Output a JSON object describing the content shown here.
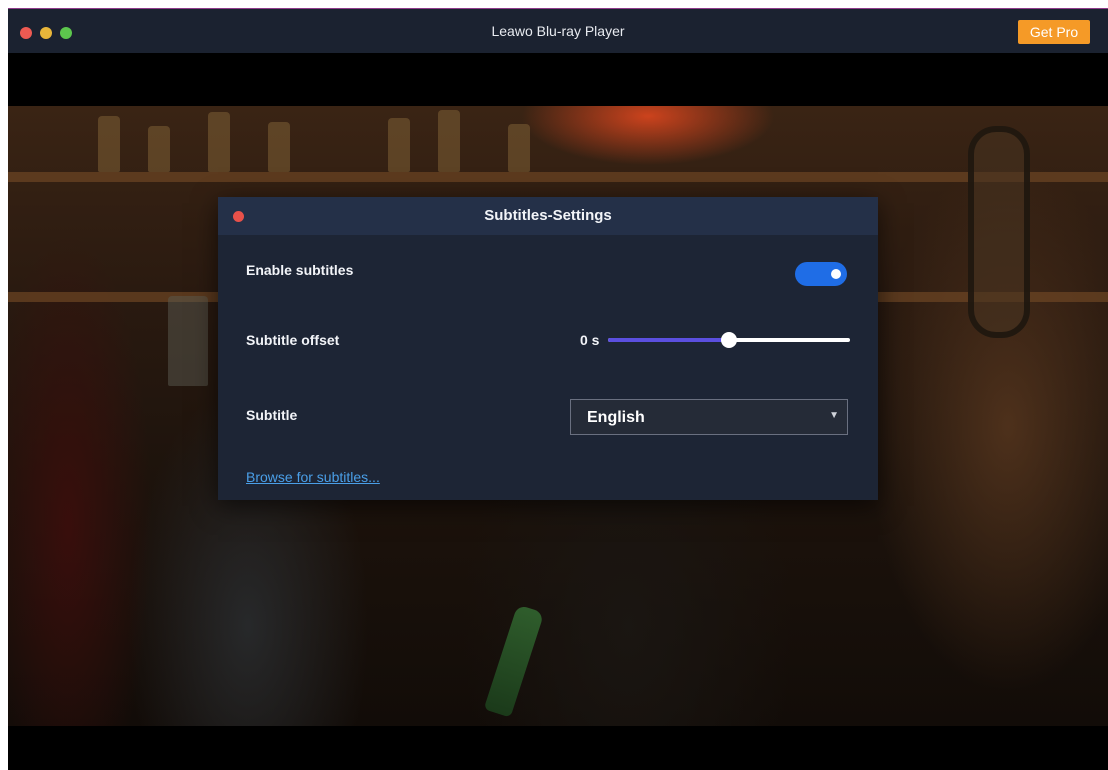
{
  "app": {
    "title": "Leawo Blu-ray Player",
    "get_pro_label": "Get Pro"
  },
  "dialog": {
    "title": "Subtitles-Settings",
    "enable_subtitles": {
      "label": "Enable subtitles",
      "enabled": true
    },
    "subtitle_offset": {
      "label": "Subtitle offset",
      "value_text": "0 s",
      "fraction": 0.5
    },
    "subtitle": {
      "label": "Subtitle",
      "selected": "English"
    },
    "browse_link": "Browse for subtitles..."
  },
  "colors": {
    "title_bar": "#1b2230",
    "get_pro_button": "#f59a27",
    "dialog_background": "#1d2535",
    "toggle_on": "#1f6de6",
    "slider_fill": "#5b4fe0",
    "link": "#4a9fe8"
  },
  "icons": {
    "close": "close-icon",
    "minimize": "minimize-icon",
    "maximize": "maximize-icon",
    "dropdown": "chevron-down-icon"
  }
}
